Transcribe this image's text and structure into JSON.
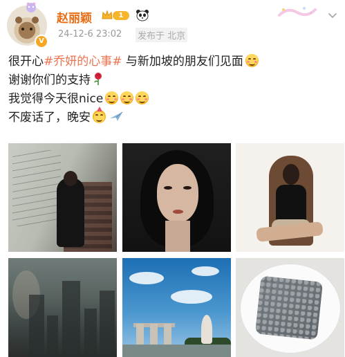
{
  "user": {
    "name": "赵丽颖",
    "vip_level": "1",
    "verified": "V"
  },
  "post": {
    "time": "24-12-6 23:02",
    "location": "发布于 北京",
    "lines": [
      {
        "before": "很开心",
        "topic": "#乔妍的心事#",
        "after": " 与新加坡的朋友们见面"
      },
      {
        "text": "谢谢你们的支持"
      },
      {
        "text": "我觉得今天很nice"
      },
      {
        "text": "不废话了，晚安"
      }
    ]
  },
  "icons": {
    "emoji_line1": "blushing-face",
    "emoji_line2": "rose",
    "emoji_line3": "smiling-face",
    "emoji_line4_a": "party-face",
    "emoji_line4_b": "airplane"
  },
  "photos": [
    "photo-woman-on-staircase",
    "photo-portrait-closeup",
    "photo-seated-in-chair",
    "photo-reflection-city-window",
    "photo-marina-bay-skyline",
    "photo-dessert-on-plate"
  ],
  "colors": {
    "username": "#e86c12",
    "topic": "#eb7350",
    "meta": "#999999"
  }
}
